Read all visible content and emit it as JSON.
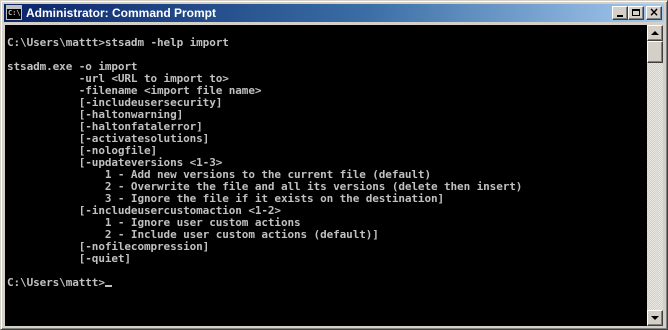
{
  "window": {
    "title": "Administrator: Command Prompt",
    "icon_text": "C:\\",
    "buttons": {
      "minimize": "minimize-icon",
      "maximize": "maximize-icon",
      "close": "close-icon",
      "close_glyph": "×"
    }
  },
  "console": {
    "colors": {
      "background": "#000000",
      "text": "#c0c0c0"
    },
    "lines": [
      "",
      "C:\\Users\\mattt>stsadm -help import",
      "",
      "stsadm.exe -o import",
      "           -url <URL to import to>",
      "           -filename <import file name>",
      "           [-includeusersecurity]",
      "           [-haltonwarning]",
      "           [-haltonfatalerror]",
      "           [-activatesolutions]",
      "           [-nologfile]",
      "           [-updateversions <1-3>",
      "               1 - Add new versions to the current file (default)",
      "               2 - Overwrite the file and all its versions (delete then insert)",
      "               3 - Ignore the file if it exists on the destination]",
      "           [-includeusercustomaction <1-2>",
      "               1 - Ignore user custom actions",
      "               2 - Include user custom actions (default)]",
      "           [-nofilecompression]",
      "           [-quiet]",
      "",
      "C:\\Users\\mattt>"
    ]
  },
  "scrollbar": {
    "up_icon": "scroll-up-arrow-icon",
    "down_icon": "scroll-down-arrow-icon"
  }
}
